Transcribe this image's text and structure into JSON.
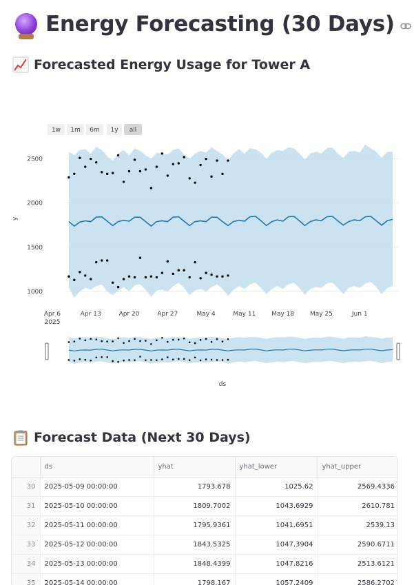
{
  "page": {
    "title": "Energy Forecasting (30 Days)",
    "title_icon": "crystal-ball-icon",
    "anchor_icon": "link-icon"
  },
  "chart_section": {
    "heading": "Forecasted Energy Usage for Tower A",
    "icon": "chart-increasing-icon"
  },
  "table_section": {
    "heading": "Forecast Data (Next 30 Days)",
    "icon": "clipboard-icon"
  },
  "chart_data": {
    "type": "line",
    "range_buttons": [
      "1w",
      "1m",
      "6m",
      "1y",
      "all"
    ],
    "active_range": "all",
    "ylabel": "y",
    "xlabel": "ds",
    "yticks": [
      1000,
      1500,
      2000,
      2500
    ],
    "ylim": [
      930,
      2660
    ],
    "xticks": [
      {
        "date": "2025-04-06",
        "label": "Apr 6",
        "sublabel": "2025"
      },
      {
        "date": "2025-04-13",
        "label": "Apr 13"
      },
      {
        "date": "2025-04-20",
        "label": "Apr 20"
      },
      {
        "date": "2025-04-27",
        "label": "Apr 27"
      },
      {
        "date": "2025-05-04",
        "label": "May 4"
      },
      {
        "date": "2025-05-11",
        "label": "May 11"
      },
      {
        "date": "2025-05-18",
        "label": "May 18"
      },
      {
        "date": "2025-05-25",
        "label": "May 25"
      },
      {
        "date": "2025-06-01",
        "label": "Jun 1"
      }
    ],
    "x_start": "2025-04-09",
    "x_end": "2025-06-07",
    "forecast_yhat": [
      1790,
      1740,
      1785,
      1800,
      1790,
      1840,
      1845,
      1795,
      1745,
      1790,
      1805,
      1795,
      1840,
      1840,
      1790,
      1740,
      1790,
      1800,
      1790,
      1840,
      1845,
      1795,
      1745,
      1790,
      1800,
      1790,
      1840,
      1840,
      1790,
      1745,
      1790,
      1805,
      1795,
      1845,
      1850,
      1800,
      1745,
      1790,
      1810,
      1795,
      1845,
      1850,
      1800,
      1745,
      1790,
      1810,
      1800,
      1845,
      1850,
      1800,
      1750,
      1790,
      1810,
      1800,
      1845,
      1850,
      1800,
      1750,
      1800,
      1815
    ],
    "forecast_upper": [
      2580,
      2540,
      2600,
      2610,
      2560,
      2640,
      2600,
      2530,
      2480,
      2560,
      2600,
      2540,
      2620,
      2590,
      2540,
      2500,
      2570,
      2560,
      2550,
      2600,
      2620,
      2550,
      2500,
      2560,
      2590,
      2570,
      2630,
      2590,
      2550,
      2480,
      2560,
      2610,
      2560,
      2620,
      2610,
      2570,
      2500,
      2570,
      2600,
      2590,
      2630,
      2620,
      2560,
      2490,
      2560,
      2580,
      2560,
      2620,
      2630,
      2560,
      2510,
      2580,
      2590,
      2570,
      2660,
      2620,
      2580,
      2510,
      2580,
      2580
    ],
    "forecast_lower": [
      1040,
      930,
      1000,
      1040,
      1020,
      1060,
      1080,
      1000,
      960,
      1010,
      1050,
      1000,
      1070,
      1080,
      1020,
      940,
      1010,
      1020,
      1000,
      1060,
      1100,
      1040,
      960,
      1010,
      1030,
      1000,
      1050,
      1080,
      1030,
      950,
      1020,
      1060,
      1030,
      1080,
      1100,
      1040,
      970,
      1030,
      1060,
      1030,
      1080,
      1100,
      1040,
      960,
      1030,
      1050,
      1040,
      1090,
      1100,
      1040,
      970,
      1040,
      1060,
      1040,
      1090,
      1110,
      1050,
      970,
      1040,
      1060
    ],
    "actual_upper": [
      2290,
      2330,
      2510,
      2410,
      2500,
      2460,
      2350,
      2330,
      2340,
      2540,
      2240,
      2360,
      2490,
      2360,
      2380,
      2170,
      2410,
      2560,
      2310,
      2440,
      2450,
      2520,
      2280,
      2230,
      2430,
      2500,
      2300,
      2480,
      2330,
      2480
    ],
    "actual_lower": [
      1170,
      1130,
      1220,
      1180,
      1140,
      1330,
      1350,
      1350,
      1100,
      1050,
      1140,
      1170,
      1160,
      1380,
      1160,
      1170,
      1160,
      1210,
      1340,
      1200,
      1240,
      1240,
      1160,
      1330,
      1150,
      1210,
      1190,
      1170,
      1170,
      1180
    ]
  },
  "table": {
    "columns": [
      "",
      "ds",
      "yhat",
      "yhat_lower",
      "yhat_upper"
    ],
    "rows": [
      [
        "30",
        "2025-05-09 00:00:00",
        "1793.678",
        "1025.62",
        "2569.4336"
      ],
      [
        "31",
        "2025-05-10 00:00:00",
        "1809.7002",
        "1043.6929",
        "2610.781"
      ],
      [
        "32",
        "2025-05-11 00:00:00",
        "1795.9361",
        "1041.6951",
        "2539.13"
      ],
      [
        "33",
        "2025-05-12 00:00:00",
        "1843.5325",
        "1047.3904",
        "2590.6711"
      ],
      [
        "34",
        "2025-05-13 00:00:00",
        "1848.4399",
        "1047.8216",
        "2513.6121"
      ],
      [
        "35",
        "2025-05-14 00:00:00",
        "1798.167",
        "1057.2409",
        "2586.2702"
      ]
    ]
  }
}
